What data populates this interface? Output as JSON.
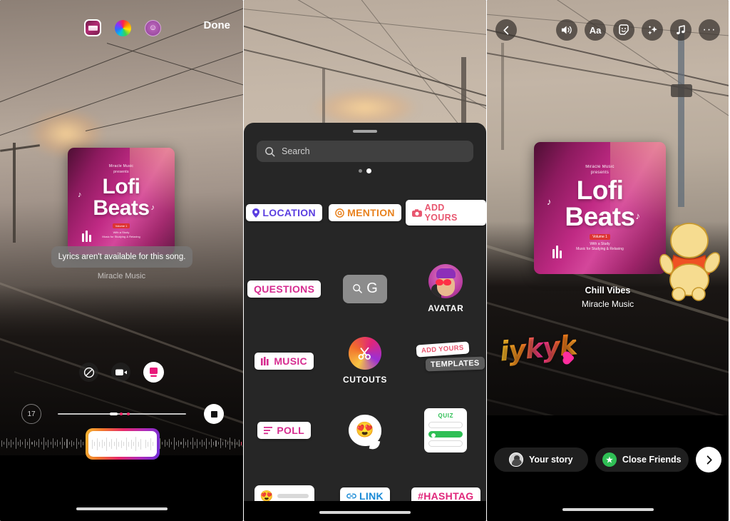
{
  "panel1": {
    "top_icons": [
      {
        "name": "album-art-thumb",
        "label": "Album art"
      },
      {
        "name": "color-wheel",
        "label": "Color"
      },
      {
        "name": "emoji-style",
        "label": "Emoji"
      }
    ],
    "done_label": "Done",
    "album": {
      "presents_line1": "Miracle Music",
      "presents_line2": "presents",
      "title_line1": "Lofi",
      "title_line2": "Beats",
      "volume_tag": "Volume 1",
      "sub_line1": "With a Study",
      "sub_line2": "Music for Studying & Relaxing"
    },
    "toast": "Lyrics aren't available for this song.",
    "artist": "Miracle Music",
    "modes": [
      {
        "name": "no-cover-mode",
        "label": "No cover"
      },
      {
        "name": "video-cover-mode",
        "label": "Video"
      },
      {
        "name": "album-cover-mode",
        "label": "Album cover"
      }
    ],
    "duration_badge": "17",
    "stop_label": "Stop",
    "trim_label": "Trim selection"
  },
  "panel2": {
    "search_placeholder": "Search",
    "search_value": "",
    "page_dots": 2,
    "page_active": 2,
    "stickers": [
      {
        "name": "location-sticker",
        "label": "LOCATION",
        "icon": "pin-icon"
      },
      {
        "name": "mention-sticker",
        "label": "MENTION",
        "icon": "at-icon"
      },
      {
        "name": "add-yours-sticker",
        "label": "ADD YOURS",
        "icon": "camera-icon"
      },
      {
        "name": "questions-sticker",
        "label": "QUESTIONS",
        "icon": ""
      },
      {
        "name": "google-search-sticker",
        "label": "G",
        "icon": "search-icon"
      },
      {
        "name": "avatar-sticker",
        "label": "AVATAR",
        "icon": "avatar-icon"
      },
      {
        "name": "music-sticker",
        "label": "MUSIC",
        "icon": "equalizer-icon"
      },
      {
        "name": "cutouts-sticker",
        "label": "CUTOUTS",
        "icon": "scissors-icon"
      },
      {
        "name": "templates-sticker",
        "label": "TEMPLATES",
        "icon": ""
      },
      {
        "name": "poll-sticker",
        "label": "POLL",
        "icon": "bars-icon"
      },
      {
        "name": "emoji-reaction-sticker",
        "label": "",
        "icon": "heart-eyes-icon"
      },
      {
        "name": "quiz-sticker",
        "label": "QUIZ",
        "icon": ""
      },
      {
        "name": "emoji-slider-sticker",
        "label": "",
        "icon": "heart-eyes-icon"
      },
      {
        "name": "link-sticker",
        "label": "LINK",
        "icon": "chain-icon"
      },
      {
        "name": "hashtag-sticker",
        "label": "#HASHTAG",
        "icon": ""
      }
    ],
    "add_yours_on_templates": "ADD YOURS"
  },
  "panel3": {
    "toolbar": [
      {
        "name": "back-button",
        "icon": "chevron-left-icon"
      },
      {
        "name": "sound-button",
        "icon": "speaker-icon"
      },
      {
        "name": "text-button",
        "icon": "text-aa-icon"
      },
      {
        "name": "sticker-button",
        "icon": "sticker-smiley-icon"
      },
      {
        "name": "effects-button",
        "icon": "sparkles-icon"
      },
      {
        "name": "music-button",
        "icon": "music-note-icon"
      },
      {
        "name": "more-button",
        "icon": "more-dots-icon"
      }
    ],
    "more_label": "···",
    "album": {
      "presents_line1": "Miracle Music",
      "presents_line2": "presents",
      "title_line1": "Lofi",
      "title_line2": "Beats",
      "volume_tag": "Volume 1",
      "sub_line1": "With a Study",
      "sub_line2": "Music for Studying & Relaxing"
    },
    "song_title": "Chill Vibes",
    "song_artist": "Miracle Music",
    "text_sticker": "iykyk",
    "share": {
      "your_story": "Your story",
      "close_friends": "Close Friends",
      "next_icon": "chevron-right-icon"
    }
  },
  "colors": {
    "accent_pink": "#e0267a",
    "purple": "#5b3fe0",
    "orange": "#e8821f",
    "green": "#2fbf55",
    "blue": "#1a8ad6",
    "tray_bg": "#262626"
  }
}
